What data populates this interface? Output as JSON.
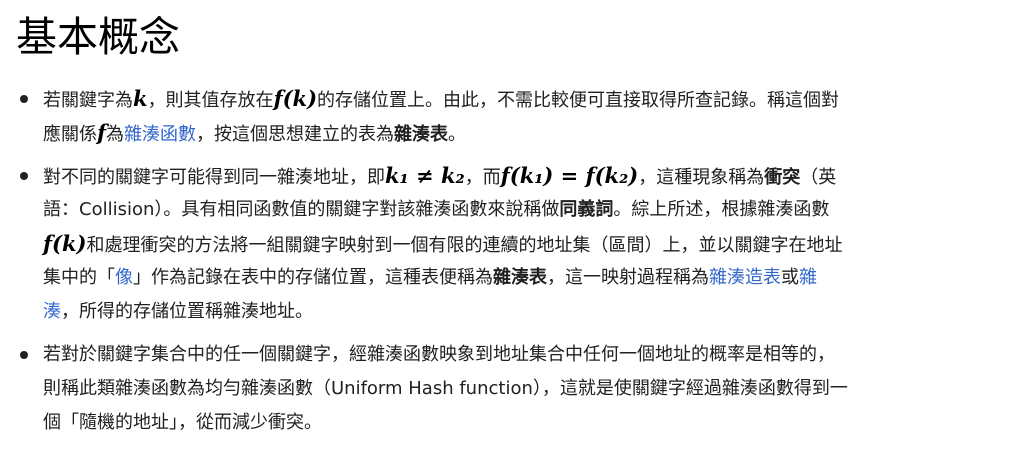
{
  "heading": "基本概念",
  "b1": {
    "l1_a": "若關鍵字為",
    "k": "k",
    "l1_b": "，則其值存放在",
    "fk": "f(k)",
    "l1_c": "的存儲位置上。由此，不需比較便可直接取得所查記錄。稱這個對",
    "l2_a": "應關係",
    "f": "f",
    "l2_b": "為",
    "link_hash_function": "雜湊函數",
    "l2_c": "，按這個思想建立的表為",
    "bold_hash_table": "雜湊表",
    "l2_d": "。"
  },
  "b2": {
    "l1_a": "對不同的關鍵字可能得到同一雜湊地址，即",
    "ineq": "k₁ ≠ k₂",
    "l1_b": "，而",
    "eq": "f(k₁) = f(k₂)",
    "l1_c": "，這種現象稱為",
    "bold_collision": "衝突",
    "l1_d": "（英",
    "l2_a": "語：Collision）。具有相同函數值的關鍵字對該雜湊函數來說稱做",
    "bold_synonym": "同義詞",
    "l2_b": "。綜上所述，根據雜湊函數",
    "fk": "f(k)",
    "l3_a": "和處理衝突的方法將一組關鍵字映射到一個有限的連續的地址集（區間）上，並以關鍵字在地址",
    "l4_a": "集中的「",
    "link_image": "像",
    "l4_b": "」作為記錄在表中的存儲位置，這種表便稱為",
    "bold_hash_table": "雜湊表",
    "l4_c": "，這一映射過程稱為",
    "link_hash_build": "雜湊造表",
    "l4_d": "或",
    "link_hash_1": "雜",
    "link_hash_2": "湊",
    "l5_a": "，所得的存儲位置稱雜湊地址。"
  },
  "b3": {
    "l1": "若對於關鍵字集合中的任一個關鍵字，經雜湊函數映象到地址集合中任何一個地址的概率是相等的，",
    "l2": "則稱此類雜湊函數為均勻雜湊函數（Uniform Hash function），這就是使關鍵字經過雜湊函數得到一",
    "l3": "個「隨機的地址」，從而減少衝突。"
  }
}
